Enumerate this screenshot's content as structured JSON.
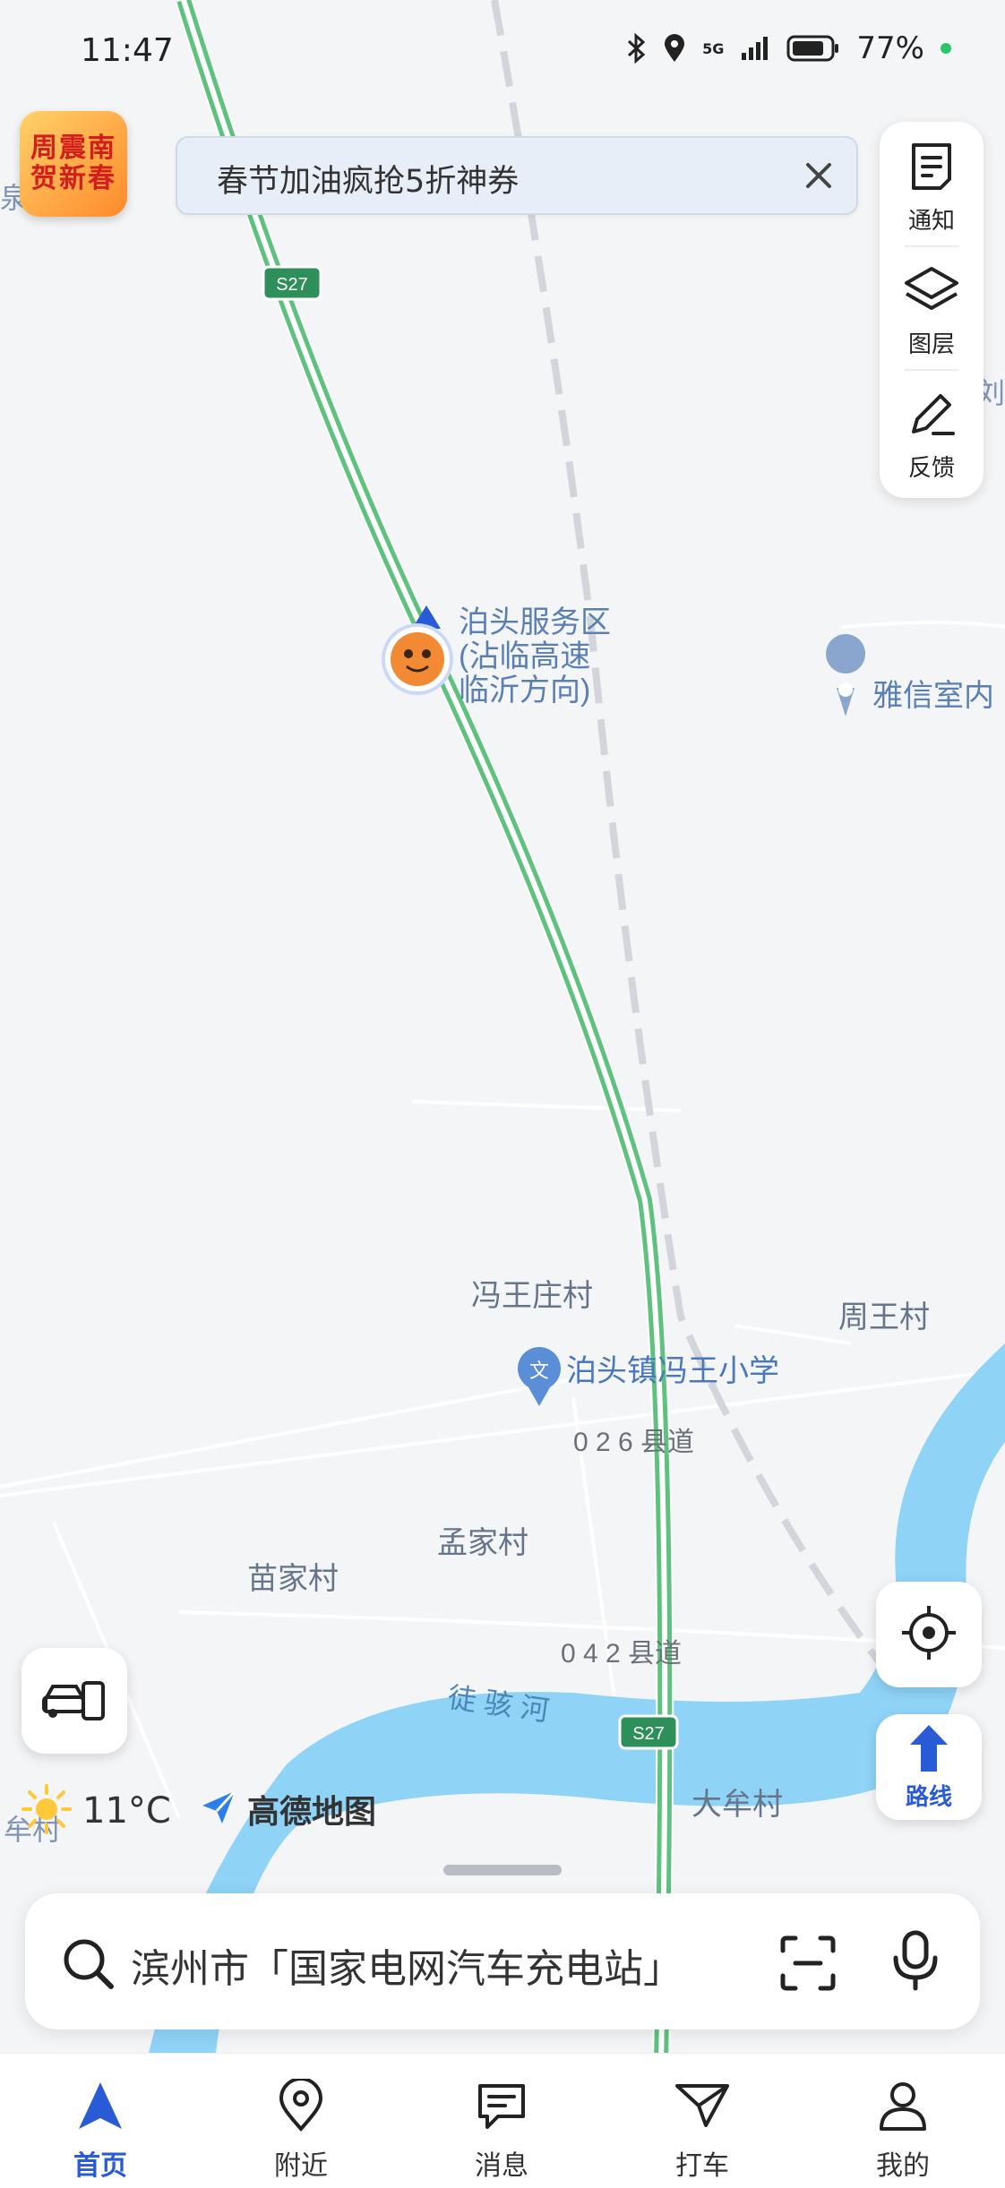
{
  "status_bar": {
    "time": "11:47",
    "network": "5G",
    "battery": "77%"
  },
  "promo_badge": {
    "line1": "周震南",
    "line2": "贺新春"
  },
  "banner": {
    "text": "春节加油疯抢5折神券"
  },
  "right_panel": {
    "items": [
      {
        "label": "通知",
        "icon": "notice-icon"
      },
      {
        "label": "图层",
        "icon": "layers-icon"
      },
      {
        "label": "反馈",
        "icon": "feedback-icon"
      }
    ]
  },
  "map": {
    "highway_shield_1": "S27",
    "highway_shield_2": "S27",
    "poi_service_area": {
      "line1": "泊头服务区",
      "line2": "(沾临高速",
      "line3": "临沂方向)"
    },
    "poi_yaxin": "雅信室内",
    "village_fengwang": "冯王庄村",
    "village_zhouwang": "周王村",
    "school": "泊头镇冯王小学",
    "road_026": "0 2 6 县道",
    "village_mengjia": "孟家村",
    "village_miaojia": "苗家村",
    "road_042": "0 4 2 县道",
    "river": "徒 骇 河",
    "village_damou": "大牟村",
    "edge_label_left_top": "泉村",
    "edge_label_right": "刘村",
    "edge_label_left_bottom": "牟村",
    "colors": {
      "water": "#8fd3f7",
      "highway": "#5ec27e",
      "rail": "#cfd3d8",
      "road": "#ffffff"
    }
  },
  "locate_button": {
    "icon": "locate-icon"
  },
  "route_button": {
    "label": "路线"
  },
  "car_button": {
    "icon": "car-phone-icon"
  },
  "weather": {
    "temp": "11°C",
    "icon": "sun-icon"
  },
  "brand": {
    "name": "高德地图"
  },
  "search": {
    "text": "滨州市「国家电网汽车充电站」"
  },
  "tabs": [
    {
      "label": "首页",
      "icon": "home-nav-icon",
      "active": true
    },
    {
      "label": "附近",
      "icon": "nearby-pin-icon",
      "active": false
    },
    {
      "label": "消息",
      "icon": "message-icon",
      "active": false
    },
    {
      "label": "打车",
      "icon": "taxi-icon",
      "active": false
    },
    {
      "label": "我的",
      "icon": "profile-icon",
      "active": false
    }
  ]
}
